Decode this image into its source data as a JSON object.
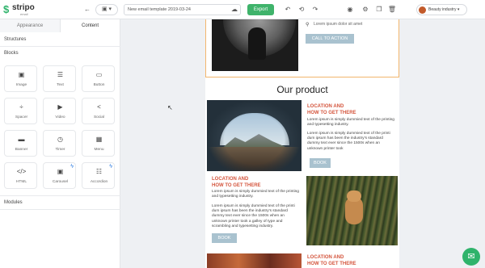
{
  "app": {
    "logo": "stripo",
    "logo_sub": "email"
  },
  "toolbar": {
    "template_name": "New email template 2019-03-24",
    "export_label": "Export",
    "user_label": "Beauty industry"
  },
  "panel": {
    "tabs": [
      "Appearance",
      "Content"
    ],
    "structures_label": "Structures",
    "blocks_label": "Blocks",
    "modules_label": "Modules",
    "blocks": [
      {
        "label": "Image",
        "icon": "image-icon",
        "glyph": "▣"
      },
      {
        "label": "Text",
        "icon": "text-icon",
        "glyph": "☰"
      },
      {
        "label": "Button",
        "icon": "button-icon",
        "glyph": "▭"
      },
      {
        "label": "Spacer",
        "icon": "spacer-icon",
        "glyph": "÷"
      },
      {
        "label": "Video",
        "icon": "video-icon",
        "glyph": "▶"
      },
      {
        "label": "Social",
        "icon": "social-icon",
        "glyph": "<"
      },
      {
        "label": "Banner",
        "icon": "banner-icon",
        "glyph": "▬"
      },
      {
        "label": "Timer",
        "icon": "timer-icon",
        "glyph": "◷"
      },
      {
        "label": "Menu",
        "icon": "menu-icon",
        "glyph": "▦"
      },
      {
        "label": "HTML",
        "icon": "html-icon",
        "glyph": "</>"
      },
      {
        "label": "Carousel",
        "icon": "carousel-icon",
        "glyph": "▣"
      },
      {
        "label": "Accordion",
        "icon": "accordion-icon",
        "glyph": "☷"
      }
    ]
  },
  "email": {
    "top_text": "Lorem ipsum dolor sit amet",
    "top_button": "CALL TO ACTION",
    "product_title": "Our product",
    "item1": {
      "title_line1": "LOCATION AND",
      "title_line2": "HOW TO GET THERE",
      "body1": "Lorem ipsum is simply dummied text of the printing and typesetting industry.",
      "body2": "Lorem ipsum is simply dummied text of the printi dum ipsum has been the industry's standard dummy text ever since the 1500s when an unknown printer took",
      "button": "BOOK"
    },
    "item2": {
      "title_line1": "LOCATION AND",
      "title_line2": "HOW TO GET THERE",
      "body1": "Lorem ipsum is simply dummied text of the printing and typesetting industry.",
      "body2": "Lorem ipsum is simply dummied text of the printi dum ipsum has been the industry's standard dummy text ever since the 1500s when an unknown printer took a galley of type and scrambling and typesetting industry.",
      "button": "BOOK"
    },
    "item3": {
      "title_line1": "LOCATION AND",
      "title_line2": "HOW TO GET THERE"
    }
  },
  "help_icon": "chat-icon"
}
